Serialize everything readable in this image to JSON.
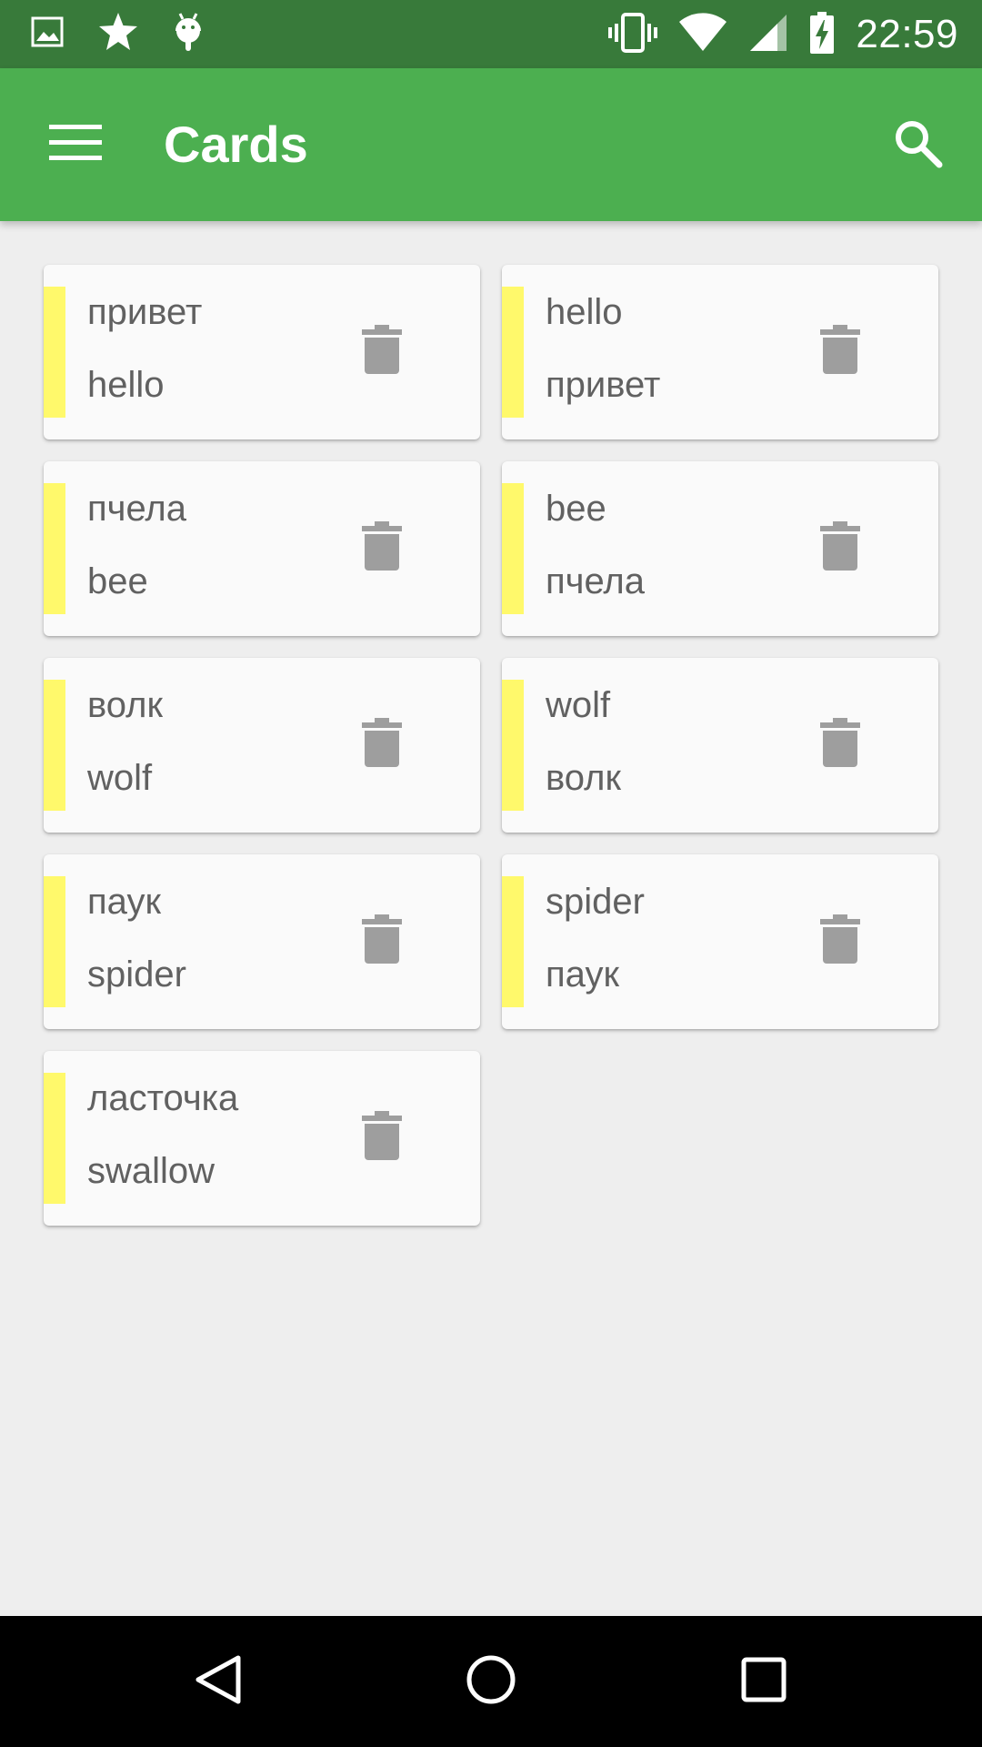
{
  "status_bar": {
    "time": "22:59",
    "left_icons": [
      "image-icon",
      "star-icon",
      "android-icon"
    ],
    "right_icons": [
      "vibrate-icon",
      "wifi-icon",
      "signal-icon",
      "battery-charging-icon"
    ]
  },
  "toolbar": {
    "title": "Cards",
    "menu_icon": "hamburger-menu-icon",
    "search_icon": "search-icon"
  },
  "colors": {
    "status_bar": "#387a3a",
    "toolbar": "#4caf50",
    "background": "#eeeeee",
    "card": "#fafafa",
    "accent": "#fff96b",
    "text": "#616161",
    "icon_gray": "#9e9e9e"
  },
  "cards": [
    {
      "front": "привет",
      "back": "hello"
    },
    {
      "front": "hello",
      "back": "привет"
    },
    {
      "front": "пчела",
      "back": "bee"
    },
    {
      "front": "bee",
      "back": "пчела"
    },
    {
      "front": "волк",
      "back": "wolf"
    },
    {
      "front": "wolf",
      "back": "волк"
    },
    {
      "front": "паук",
      "back": "spider"
    },
    {
      "front": "spider",
      "back": "паук"
    },
    {
      "front": "ласточка",
      "back": "swallow"
    }
  ],
  "nav_bar": {
    "buttons": [
      "back-icon",
      "home-icon",
      "recents-icon"
    ]
  }
}
